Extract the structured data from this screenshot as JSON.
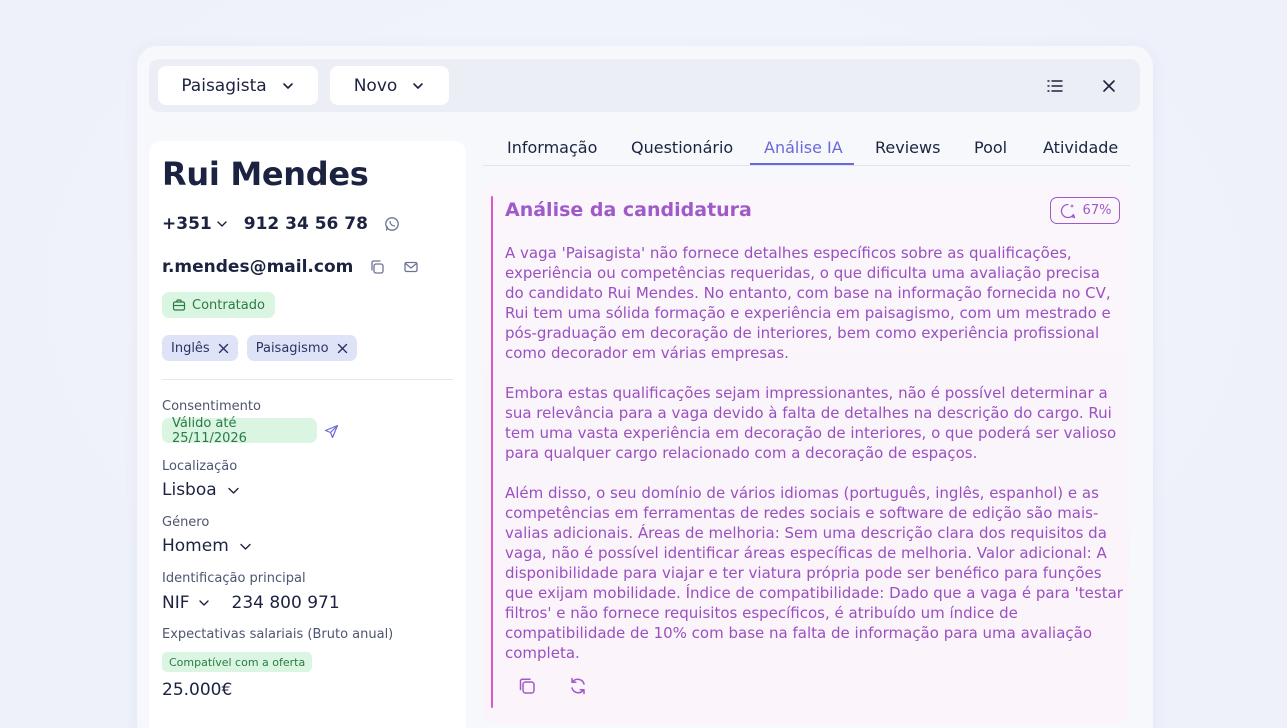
{
  "toolbar": {
    "job_select": "Paisagista",
    "status_select": "Novo",
    "list_icon": "list-icon",
    "close_icon": "close-icon"
  },
  "candidate": {
    "name": "Rui Mendes",
    "phone_code": "+351",
    "phone_number": "912 34 56 78",
    "email": "r.mendes@mail.com",
    "status_badge": "Contratado",
    "tags": [
      "Inglês",
      "Paisagismo"
    ]
  },
  "details": {
    "consent_label": "Consentimento",
    "consent_value": "Válido até 25/11/2026",
    "location_label": "Localização",
    "location_value": "Lisboa",
    "gender_label": "Género",
    "gender_value": "Homem",
    "id_label": "Identificação principal",
    "id_type": "NIF",
    "id_value": "234 800 971",
    "salary_label": "Expectativas salariais (Bruto anual)",
    "salary_badge": "Compatível com a oferta",
    "salary_value": "25.000€"
  },
  "tabs": [
    "Informação",
    "Questionário",
    "Análise IA",
    "Reviews",
    "Pool",
    "Atividade"
  ],
  "active_tab": "Análise IA",
  "analysis": {
    "title": "Análise da candidatura",
    "score": "67%",
    "paragraphs": [
      "A vaga 'Paisagista' não fornece detalhes específicos sobre as qualificações, experiência ou competências requeridas, o que dificulta uma avaliação precisa do candidato Rui Mendes. No entanto, com base na informação fornecida no CV, Rui tem uma sólida formação e experiência em paisagismo, com um mestrado e pós-graduação em decoração de interiores, bem como experiência profissional como decorador em várias empresas.",
      "Embora estas qualificações sejam impressionantes, não é possível determinar a sua relevância para a vaga devido à falta de detalhes na descrição do cargo. Rui tem uma vasta experiência em decoração de interiores, o que poderá ser valioso para qualquer cargo relacionado com a decoração de espaços.",
      "Além disso, o seu domínio de vários idiomas (português, inglês, espanhol) e as competências em ferramentas de redes sociais e software de edição são mais-valias adicionais. Áreas de melhoria: Sem uma descrição clara dos requisitos da vaga, não é possível identificar áreas específicas de melhoria. Valor adicional: A disponibilidade para viajar e ter viatura própria pode ser benéfico para funções que exijam mobilidade. Índice de compatibilidade: Dado que a vaga é para 'testar filtros' e não fornece requisitos específicos, é atribuído um índice de compatibilidade de 10% com base na falta de informação para uma avaliação completa."
    ]
  },
  "colors": {
    "accent": "#6c68d9",
    "analysis_text": "#9b4fc1",
    "analysis_bar": "#d65ac9",
    "green_badge_bg": "#daf5e2",
    "green_badge_text": "#2a7b45",
    "tag_bg": "#dfe3f7"
  }
}
